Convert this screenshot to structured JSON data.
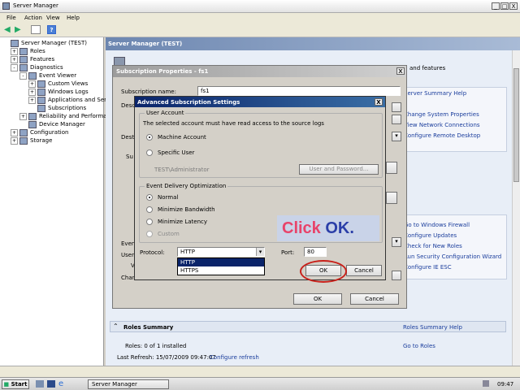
{
  "window": {
    "title": "Server Manager",
    "min": "_",
    "max": "□",
    "close": "X"
  },
  "menu": [
    "File",
    "Action",
    "View",
    "Help"
  ],
  "tree": [
    {
      "label": "Server Manager (TEST)",
      "indent": 0,
      "exp": ""
    },
    {
      "label": "Roles",
      "indent": 1,
      "exp": "+"
    },
    {
      "label": "Features",
      "indent": 1,
      "exp": "+"
    },
    {
      "label": "Diagnostics",
      "indent": 1,
      "exp": "-"
    },
    {
      "label": "Event Viewer",
      "indent": 2,
      "exp": "-"
    },
    {
      "label": "Custom Views",
      "indent": 3,
      "exp": "+"
    },
    {
      "label": "Windows Logs",
      "indent": 3,
      "exp": "+"
    },
    {
      "label": "Applications and Service",
      "indent": 3,
      "exp": "+"
    },
    {
      "label": "Subscriptions",
      "indent": 3,
      "exp": ""
    },
    {
      "label": "Reliability and Performance",
      "indent": 2,
      "exp": "+"
    },
    {
      "label": "Device Manager",
      "indent": 2,
      "exp": ""
    },
    {
      "label": "Configuration",
      "indent": 1,
      "exp": "+"
    },
    {
      "label": "Storage",
      "indent": 1,
      "exp": "+"
    }
  ],
  "main": {
    "header": "Server Manager (TEST)",
    "right_text": "and features",
    "right_links": [
      "Server Summary Help",
      "Change System Properties",
      "View Network Connections",
      "Configure Remote Desktop"
    ],
    "lower_links": [
      "Go to Windows Firewall",
      "Configure Updates",
      "Check for New Roles",
      "Run Security Configuration Wizard",
      "Configure IE ESC"
    ],
    "roles_summary": "Roles Summary",
    "roles_summary_help": "Roles Summary Help",
    "roles_count": "Roles: 0 of 1 installed",
    "go_to_roles": "Go to Roles",
    "last_refresh": "Last Refresh: 15/07/2009 09:47:07",
    "configure_refresh": "Configure refresh"
  },
  "sub_props": {
    "title": "Subscription Properties - fs1",
    "name_label": "Subscription name:",
    "name_value": "fs1",
    "side_labels": [
      "Desc",
      "Dest",
      "Su",
      "Even",
      "User",
      "V",
      "Chan"
    ],
    "ok": "OK",
    "cancel": "Cancel"
  },
  "adv": {
    "title": "Advanced Subscription Settings",
    "user_account_group": "User Account",
    "user_account_desc": "The selected account must have read access to the source logs",
    "machine_account": "Machine Account",
    "specific_user": "Specific User",
    "user_value": "TEST\\Administrator",
    "user_password_btn": "User and Password...",
    "delivery_group": "Event Delivery Optimization",
    "normal": "Normal",
    "min_bandwidth": "Minimize Bandwidth",
    "min_latency": "Minimize Latency",
    "custom": "Custom",
    "protocol_label": "Protocol:",
    "protocol_value": "HTTP",
    "protocol_options": [
      "HTTP",
      "HTTPS"
    ],
    "port_label": "Port:",
    "port_value": "80",
    "ok": "OK",
    "cancel": "Cancel"
  },
  "callout": {
    "prefix": "Click ",
    "emph": "OK."
  },
  "taskbar": {
    "start": "Start",
    "task": "Server Manager",
    "clock": "09:47"
  },
  "colors": {
    "callout_text": "#e8436a",
    "callout_emph": "#2b3fa8",
    "callout_bg": "#c9d3e8",
    "highlight_ring": "#c8201a"
  }
}
